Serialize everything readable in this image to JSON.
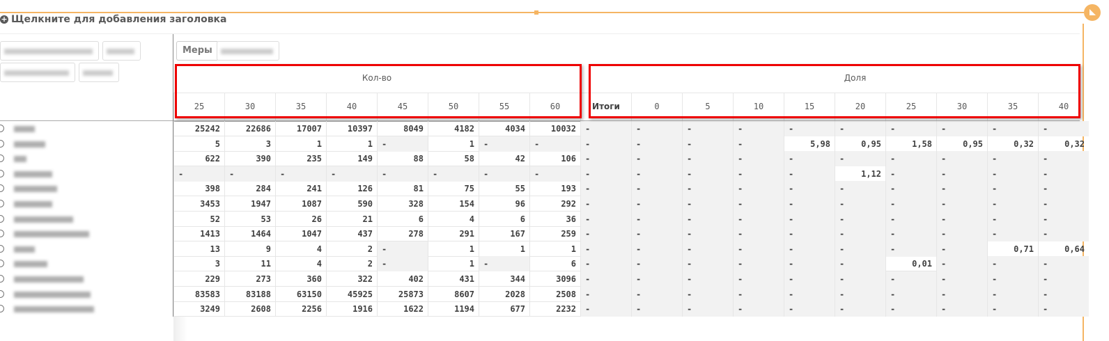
{
  "title": "Щелкните для добавления заголовка",
  "measures_label": "Меры",
  "groups": {
    "kolvo": "Кол-во",
    "dolya": "Доля",
    "itogi": "Итоги"
  },
  "kolvo_columns": [
    "25",
    "30",
    "35",
    "40",
    "45",
    "50",
    "55",
    "60"
  ],
  "dolya_columns": [
    "0",
    "5",
    "10",
    "15",
    "20",
    "25",
    "30",
    "35",
    "40"
  ],
  "colors": {
    "accent": "#f5b563",
    "highlight": "#e00000"
  },
  "rows": [
    {
      "kolvo": [
        "25242",
        "22686",
        "17007",
        "10397",
        "8049",
        "4182",
        "4034",
        "10032"
      ],
      "itogi": "-",
      "dolya": [
        "-",
        "-",
        "-",
        "-",
        "-",
        "-",
        "-",
        "-",
        "-"
      ]
    },
    {
      "kolvo": [
        "5",
        "3",
        "1",
        "1",
        "-",
        "1",
        "-",
        "-"
      ],
      "itogi": "-",
      "dolya": [
        "-",
        "-",
        "-",
        "5,98",
        "0,95",
        "1,58",
        "0,95",
        "0,32",
        "0,32"
      ]
    },
    {
      "kolvo": [
        "622",
        "390",
        "235",
        "149",
        "88",
        "58",
        "42",
        "106"
      ],
      "itogi": "-",
      "dolya": [
        "-",
        "-",
        "-",
        "-",
        "-",
        "-",
        "-",
        "-",
        "-"
      ]
    },
    {
      "kolvo": [
        "-",
        "-",
        "-",
        "-",
        "-",
        "-",
        "-",
        "-"
      ],
      "itogi": "-",
      "dolya": [
        "-",
        "-",
        "-",
        "-",
        "1,12",
        "-",
        "-",
        "-",
        "-"
      ]
    },
    {
      "kolvo": [
        "398",
        "284",
        "241",
        "126",
        "81",
        "75",
        "55",
        "193"
      ],
      "itogi": "-",
      "dolya": [
        "-",
        "-",
        "-",
        "-",
        "-",
        "-",
        "-",
        "-",
        "-"
      ]
    },
    {
      "kolvo": [
        "3453",
        "1947",
        "1087",
        "590",
        "328",
        "154",
        "96",
        "292"
      ],
      "itogi": "-",
      "dolya": [
        "-",
        "-",
        "-",
        "-",
        "-",
        "-",
        "-",
        "-",
        "-"
      ]
    },
    {
      "kolvo": [
        "52",
        "53",
        "26",
        "21",
        "6",
        "4",
        "6",
        "36"
      ],
      "itogi": "-",
      "dolya": [
        "-",
        "-",
        "-",
        "-",
        "-",
        "-",
        "-",
        "-",
        "-"
      ]
    },
    {
      "kolvo": [
        "1413",
        "1464",
        "1047",
        "437",
        "278",
        "291",
        "167",
        "259"
      ],
      "itogi": "-",
      "dolya": [
        "-",
        "-",
        "-",
        "-",
        "-",
        "-",
        "-",
        "-",
        "-"
      ]
    },
    {
      "kolvo": [
        "13",
        "9",
        "4",
        "2",
        "-",
        "1",
        "1",
        "1"
      ],
      "itogi": "-",
      "dolya": [
        "-",
        "-",
        "-",
        "-",
        "-",
        "-",
        "-",
        "0,71",
        "0,64"
      ]
    },
    {
      "kolvo": [
        "3",
        "11",
        "4",
        "2",
        "-",
        "1",
        "-",
        "6"
      ],
      "itogi": "-",
      "dolya": [
        "-",
        "-",
        "-",
        "-",
        "-",
        "0,01",
        "-",
        "-",
        "-"
      ]
    },
    {
      "kolvo": [
        "229",
        "273",
        "360",
        "322",
        "402",
        "431",
        "344",
        "3096"
      ],
      "itogi": "-",
      "dolya": [
        "-",
        "-",
        "-",
        "-",
        "-",
        "-",
        "-",
        "-",
        "-"
      ]
    },
    {
      "kolvo": [
        "83583",
        "83188",
        "63150",
        "45925",
        "25873",
        "8607",
        "2028",
        "2508"
      ],
      "itogi": "-",
      "dolya": [
        "-",
        "-",
        "-",
        "-",
        "-",
        "-",
        "-",
        "-",
        "-"
      ]
    },
    {
      "kolvo": [
        "3249",
        "2608",
        "2256",
        "1916",
        "1622",
        "1194",
        "677",
        "2232"
      ],
      "itogi": "-",
      "dolya": [
        "-",
        "-",
        "-",
        "-",
        "-",
        "-",
        "-",
        "-",
        "-"
      ]
    }
  ]
}
